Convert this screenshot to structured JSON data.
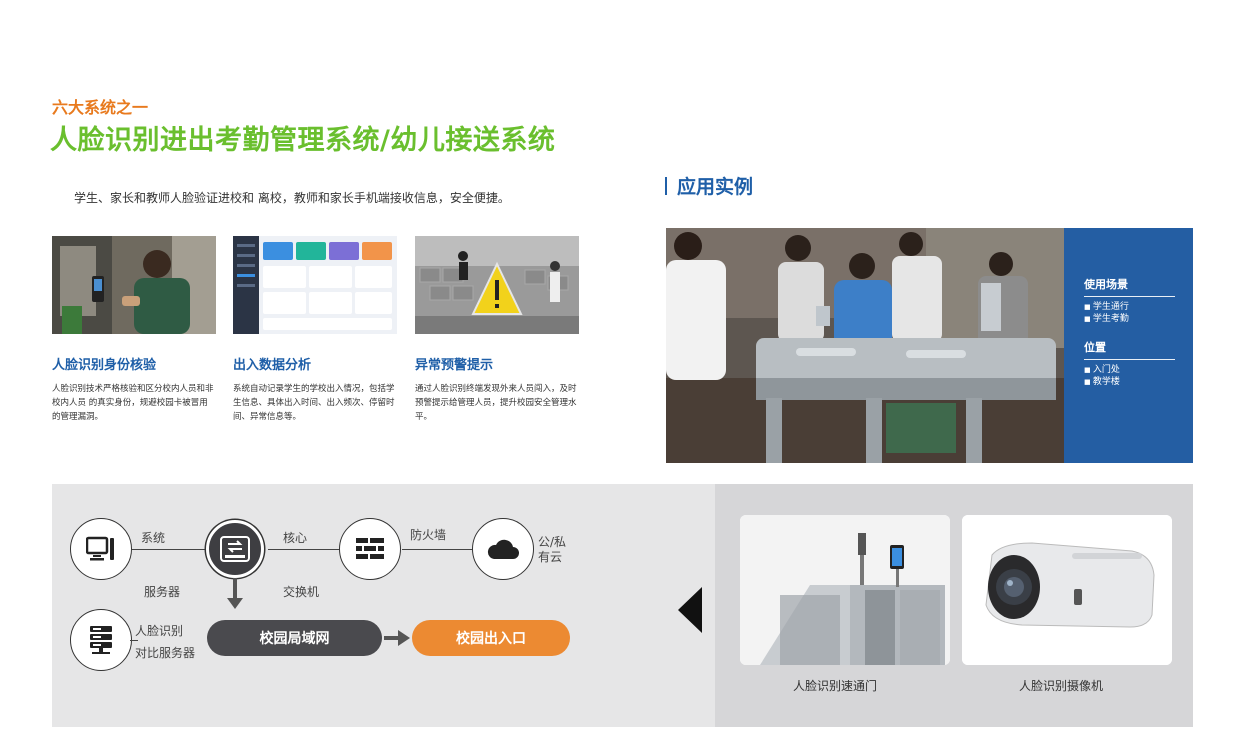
{
  "header": {
    "kicker": "六大系统之一",
    "title": "人脸识别进出考勤管理系统/幼儿接送系统",
    "intro": "学生、家长和教师人脸验证进校和 离校，教师和家长手机端接收信息，安全便捷。"
  },
  "cards": [
    {
      "title": "人脸识别身份核验",
      "desc": "人脸识别技术严格核验和区分校内人员和非校内人员 的真实身份，规避校园卡被冒用的管理漏洞。"
    },
    {
      "title": "出入数据分析",
      "desc": "系统自动记录学生的学校出入情况，包括学生信息、具体出入时间、出入频次、停留时间、异常信息等。"
    },
    {
      "title": "异常预警提示",
      "desc": "通过人脸识别终端发现外来人员闯入，及时预警提示给管理人员，提升校园安全管理水平。"
    }
  ],
  "application": {
    "heading": "应用实例",
    "scenario_heading": "使用场景",
    "scenarios": [
      "学生通行",
      "学生考勤"
    ],
    "location_heading": "位置",
    "locations": [
      "入门处",
      "教学楼"
    ]
  },
  "network": {
    "labels": {
      "system": "系统",
      "server": "服务器",
      "core": "核心",
      "switch": "交换机",
      "firewall": "防火墙",
      "cloud_1": "公/私",
      "cloud_2": "有云",
      "face_server_1": "人脸识别",
      "face_server_2": "对比服务器"
    },
    "campus_lan": "校园局域网",
    "campus_gate": "校园出入口",
    "colors": {
      "lan_pill": "#4a4a4e",
      "gate_pill": "#ec8a32",
      "icon_dark": "#3e3e42"
    }
  },
  "devices": {
    "gate_caption": "人脸识别速通门",
    "camera_caption": "人脸识别摄像机"
  },
  "colors": {
    "accent_green": "#6abf2e",
    "accent_orange": "#e87a1e",
    "brand_blue": "#1f5fa8",
    "panel_blue": "#245ea3"
  }
}
